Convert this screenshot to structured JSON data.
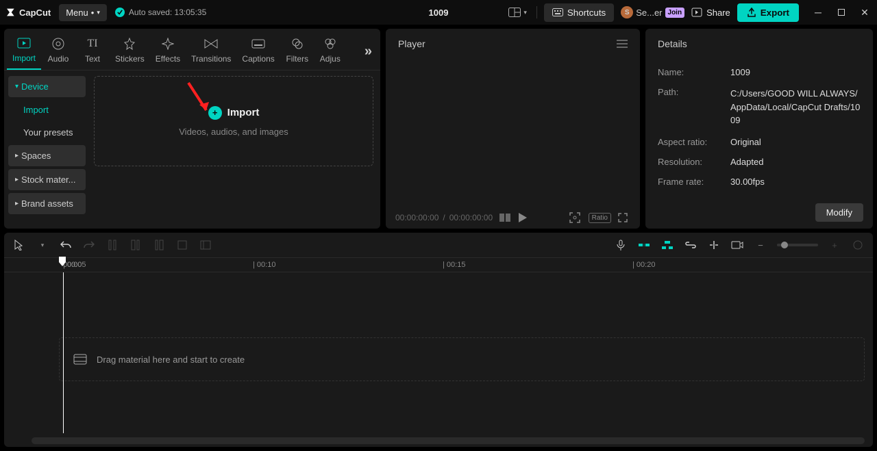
{
  "app": {
    "name": "CapCut",
    "menu_label": "Menu"
  },
  "autosave": "Auto saved: 13:05:35",
  "project_title": "1009",
  "titlebar": {
    "shortcuts": "Shortcuts",
    "user": "Se...er",
    "join": "Join",
    "share": "Share",
    "export": "Export"
  },
  "tool_tabs": [
    "Import",
    "Audio",
    "Text",
    "Stickers",
    "Effects",
    "Transitions",
    "Captions",
    "Filters",
    "Adjus"
  ],
  "media_sidebar": {
    "device": "Device",
    "import": "Import",
    "presets": "Your presets",
    "spaces": "Spaces",
    "stock": "Stock mater...",
    "brand": "Brand assets"
  },
  "import_box": {
    "label": "Import",
    "sub": "Videos, audios, and images"
  },
  "player": {
    "title": "Player",
    "time_current": "00:00:00:00",
    "time_total": "00:00:00:00",
    "ratio": "Ratio"
  },
  "details": {
    "title": "Details",
    "rows": {
      "name_label": "Name:",
      "name_value": "1009",
      "path_label": "Path:",
      "path_value": "C:/Users/GOOD WILL ALWAYS/AppData/Local/CapCut Drafts/1009",
      "aspect_label": "Aspect ratio:",
      "aspect_value": "Original",
      "resolution_label": "Resolution:",
      "resolution_value": "Adapted",
      "framerate_label": "Frame rate:",
      "framerate_value": "30.00fps"
    },
    "modify": "Modify"
  },
  "timeline": {
    "ticks": [
      "00:00",
      "| 00:05",
      "| 00:10",
      "| 00:15",
      "| 00:20"
    ],
    "drag_hint": "Drag material here and start to create"
  }
}
